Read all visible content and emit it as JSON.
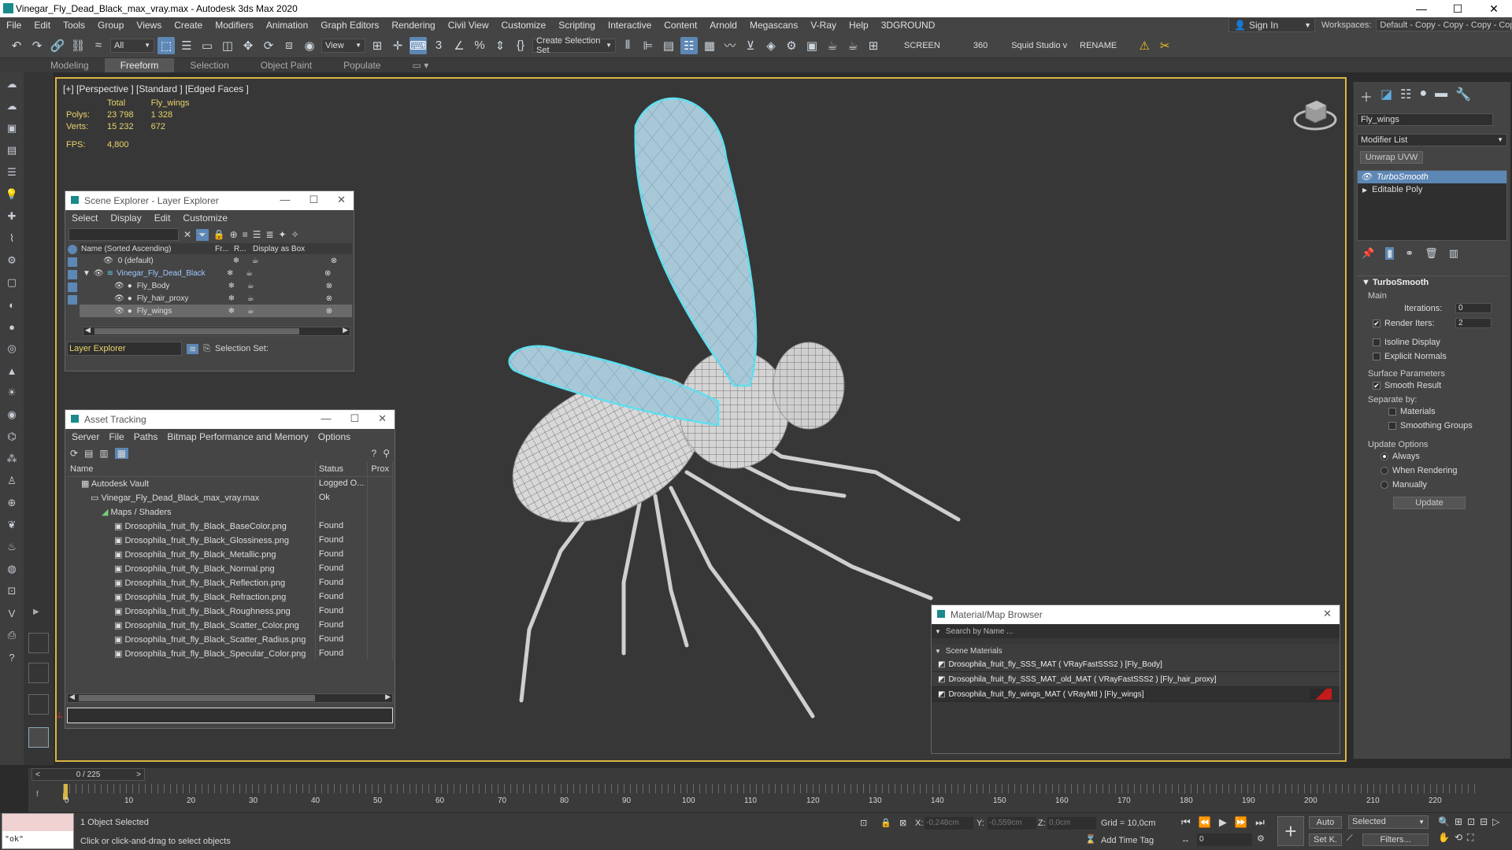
{
  "window": {
    "title": "Vinegar_Fly_Dead_Black_max_vray.max - Autodesk 3ds Max 2020",
    "minimize": "—",
    "maximize": "☐",
    "close": "✕"
  },
  "menus": [
    "File",
    "Edit",
    "Tools",
    "Group",
    "Views",
    "Create",
    "Modifiers",
    "Animation",
    "Graph Editors",
    "Rendering",
    "Civil View",
    "Customize",
    "Scripting",
    "Interactive",
    "Content",
    "Arnold",
    "Megascans",
    "V-Ray",
    "Help",
    "3DGROUND"
  ],
  "account": {
    "sign_in": "Sign In",
    "workspaces_label": "Workspaces:",
    "workspace_value": "Default - Copy - Copy - Copy - Copy"
  },
  "toolbar": {
    "filter": "All",
    "view": "View",
    "named_selection": "Create Selection Set",
    "screen": "SCREEN",
    "value_360": "360",
    "squid": "Squid Studio v",
    "rename": "RENAME"
  },
  "ribbon_tabs": [
    "Modeling",
    "Freeform",
    "Selection",
    "Object Paint",
    "Populate"
  ],
  "viewport": {
    "label": "[+] [Perspective ] [Standard ] [Edged Faces ]",
    "stats": {
      "col_total": "Total",
      "col_obj": "Fly_wings",
      "polys_label": "Polys:",
      "polys_total": "23 798",
      "polys_obj": "1 328",
      "verts_label": "Verts:",
      "verts_total": "15 232",
      "verts_obj": "672",
      "fps_label": "FPS:",
      "fps": "4,800"
    }
  },
  "scene_explorer": {
    "title": "Scene Explorer - Layer Explorer",
    "menus": [
      "Select",
      "Display",
      "Edit",
      "Customize"
    ],
    "col_name": "Name (Sorted Ascending)",
    "col_fr": "Fr...",
    "col_r": "R...",
    "col_box": "Display as Box",
    "rows": [
      "0 (default)",
      "Vinegar_Fly_Dead_Black",
      "Fly_Body",
      "Fly_hair_proxy",
      "Fly_wings"
    ],
    "footer_dropdown": "Layer Explorer",
    "footer_selset": "Selection Set:"
  },
  "asset_tracking": {
    "title": "Asset Tracking",
    "menus": [
      "Server",
      "File",
      "Paths",
      "Bitmap Performance and Memory",
      "Options"
    ],
    "col_name": "Name",
    "col_status": "Status",
    "col_prox": "Prox",
    "rows": [
      {
        "name": "Autodesk Vault",
        "status": "Logged O..."
      },
      {
        "name": "Vinegar_Fly_Dead_Black_max_vray.max",
        "status": "Ok"
      },
      {
        "name": "Maps / Shaders",
        "status": ""
      },
      {
        "name": "Drosophila_fruit_fly_Black_BaseColor.png",
        "status": "Found"
      },
      {
        "name": "Drosophila_fruit_fly_Black_Glossiness.png",
        "status": "Found"
      },
      {
        "name": "Drosophila_fruit_fly_Black_Metallic.png",
        "status": "Found"
      },
      {
        "name": "Drosophila_fruit_fly_Black_Normal.png",
        "status": "Found"
      },
      {
        "name": "Drosophila_fruit_fly_Black_Reflection.png",
        "status": "Found"
      },
      {
        "name": "Drosophila_fruit_fly_Black_Refraction.png",
        "status": "Found"
      },
      {
        "name": "Drosophila_fruit_fly_Black_Roughness.png",
        "status": "Found"
      },
      {
        "name": "Drosophila_fruit_fly_Black_Scatter_Color.png",
        "status": "Found"
      },
      {
        "name": "Drosophila_fruit_fly_Black_Scatter_Radius.png",
        "status": "Found"
      },
      {
        "name": "Drosophila_fruit_fly_Black_Specular_Color.png",
        "status": "Found"
      }
    ]
  },
  "material_browser": {
    "title": "Material/Map Browser",
    "search_placeholder": "Search by Name ...",
    "section": "Scene Materials",
    "items": [
      "Drosophila_fruit_fly_SSS_MAT  ( VRayFastSSS2 )  [Fly_Body]",
      "Drosophila_fruit_fly_SSS_MAT_old_MAT  ( VRayFastSSS2 )  [Fly_hair_proxy]",
      "Drosophila_fruit_fly_wings_MAT  ( VRayMtl )  [Fly_wings]"
    ]
  },
  "command_panel": {
    "object_name": "Fly_wings",
    "modifier_list": "Modifier List",
    "unwrap_btn": "Unwrap UVW",
    "stack": [
      "TurboSmooth",
      "Editable Poly"
    ],
    "rollout_title": "TurboSmooth",
    "main_label": "Main",
    "iterations_label": "Iterations:",
    "iterations_value": "0",
    "render_iters_label": "Render Iters:",
    "render_iters_value": "2",
    "isoline": "Isoline Display",
    "explicit_normals": "Explicit Normals",
    "surface_params": "Surface Parameters",
    "smooth_result": "Smooth Result",
    "separate_by": "Separate by:",
    "materials": "Materials",
    "smoothing_groups": "Smoothing Groups",
    "update_options": "Update Options",
    "always": "Always",
    "when_rendering": "When Rendering",
    "manually": "Manually",
    "update_btn": "Update"
  },
  "timeline": {
    "frame_counter": "0 / 225",
    "ticks": [
      "0",
      "10",
      "20",
      "30",
      "40",
      "50",
      "60",
      "70",
      "80",
      "90",
      "100",
      "110",
      "120",
      "130",
      "140",
      "150",
      "160",
      "170",
      "180",
      "190",
      "200",
      "210",
      "220"
    ]
  },
  "status": {
    "script_value": "\"ok\"",
    "objects_selected": "1 Object Selected",
    "prompt": "Click or click-and-drag to select objects",
    "x_label": "X:",
    "x_value": "-0,248cm",
    "y_label": "Y:",
    "y_value": "-0,559cm",
    "z_label": "Z:",
    "z_value": "0,0cm",
    "grid": "Grid = 10,0cm",
    "add_time_tag": "Add Time Tag",
    "auto": "Auto",
    "selected": "Selected",
    "set_k": "Set K.",
    "filters": "Filters...",
    "frame_value": "0"
  }
}
